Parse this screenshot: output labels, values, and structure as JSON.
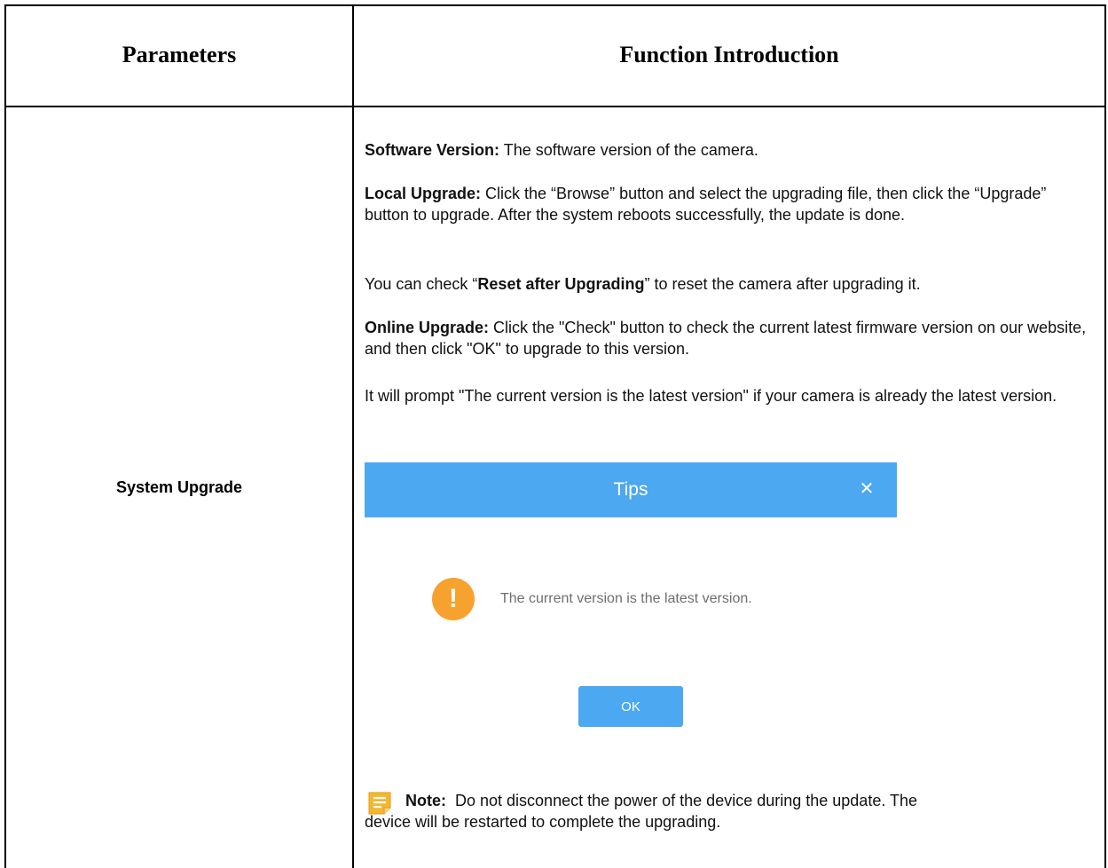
{
  "table": {
    "header_parameters": "Parameters",
    "header_function": "Function Introduction",
    "parameter_name": "System Upgrade"
  },
  "content": {
    "software_version_label": "Software Version:",
    "software_version_text": " The software version of the camera.",
    "local_upgrade_label": "Local Upgrade:",
    "local_upgrade_text": " Click the “Browse” button and select the upgrading file, then click the “Upgrade” button to upgrade. After the system reboots successfully, the update is done.",
    "reset_prefix": "You can check “",
    "reset_bold": "Reset after Upgrading",
    "reset_suffix": "” to reset the camera after upgrading it.",
    "online_upgrade_label": "Online Upgrade:",
    "online_upgrade_text": " Click the \"Check\" button to check the current latest firmware version on our website, and then click \"OK\" to upgrade to this version.",
    "prompt_text": "It will prompt \"The current version is the latest version\" if your camera is already the latest version."
  },
  "dialog": {
    "title": "Tips",
    "close_glyph": "✕",
    "warning_glyph": "!",
    "message": "The current version is the latest version.",
    "ok_label": "OK",
    "accent_color": "#4ca8f0",
    "warning_color": "#f7a12f"
  },
  "note": {
    "label": "Note:",
    "line1": "  Do not disconnect the power of the device during the update. The",
    "line2": "device will be restarted to complete the upgrading.",
    "icon": "note-icon",
    "icon_color": "#f5b733"
  }
}
